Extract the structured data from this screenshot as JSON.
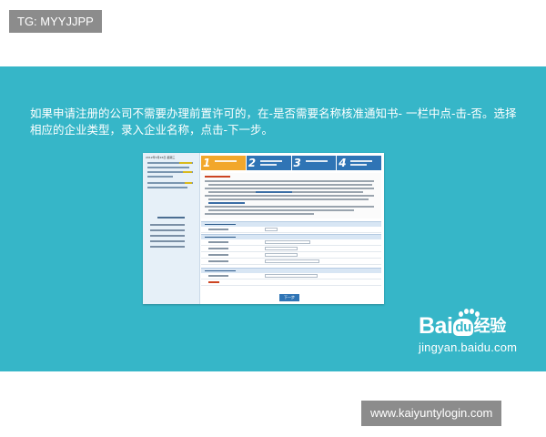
{
  "top_tag": "TG: MYYJJPP",
  "instruction": "如果申请注册的公司不需要办理前置许可的，在-是否需要名称核准通知书- 一栏中点-击-否。选择相应的企业类型，录入企业名称，点击-下一步。",
  "screenshot": {
    "date_text": "2012年3月26日 星期三",
    "steps": [
      "1",
      "2",
      "3",
      "4"
    ],
    "next_button": "下一步"
  },
  "logo": {
    "brand_left": "Bai",
    "brand_du": "du",
    "brand_right": "经验",
    "domain": "jingyan.baidu.com"
  },
  "bottom_site": "www.kaiyuntylogin.com",
  "colors": {
    "banner": "#36b6c8",
    "tag_bg": "#8c8c8c",
    "step_active": "#f2a72b",
    "step": "#2f74b5"
  }
}
